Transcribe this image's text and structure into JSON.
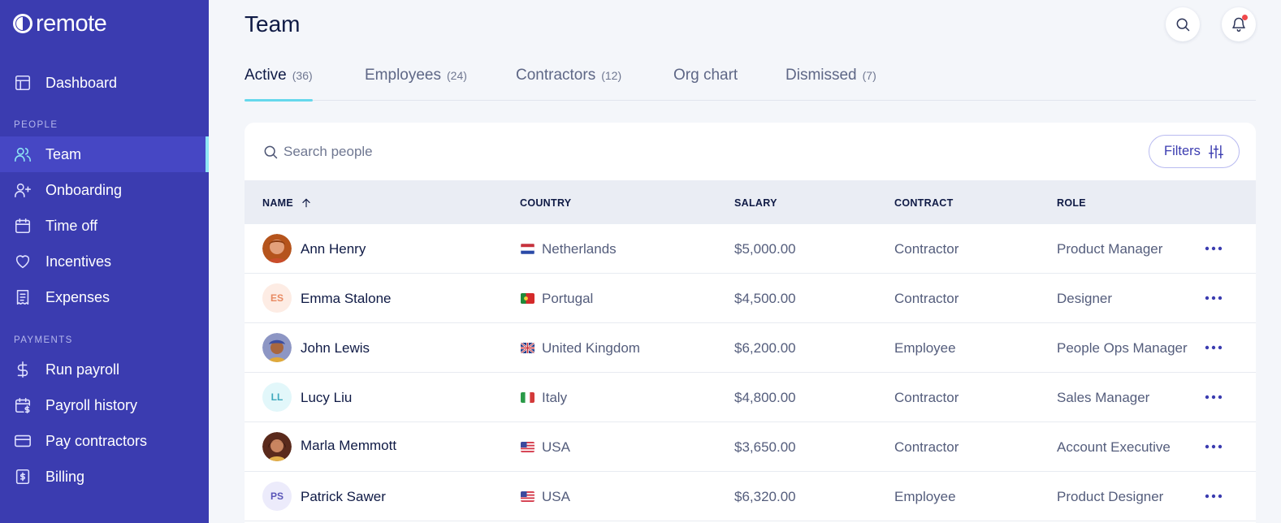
{
  "app": {
    "logo_text": "remote"
  },
  "sidebar": {
    "dashboard": "Dashboard",
    "people_label": "PEOPLE",
    "people_items": [
      {
        "label": "Team",
        "icon": "users-icon"
      },
      {
        "label": "Onboarding",
        "icon": "user-plus-icon"
      },
      {
        "label": "Time off",
        "icon": "calendar-icon"
      },
      {
        "label": "Incentives",
        "icon": "heart-icon"
      },
      {
        "label": "Expenses",
        "icon": "receipt-icon"
      }
    ],
    "payments_label": "PAYMENTS",
    "payment_items": [
      {
        "label": "Run payroll",
        "icon": "dollar-icon"
      },
      {
        "label": "Payroll history",
        "icon": "calendar-dollar-icon"
      },
      {
        "label": "Pay contractors",
        "icon": "credit-card-icon"
      },
      {
        "label": "Billing",
        "icon": "billing-icon"
      }
    ],
    "active_item": "Team"
  },
  "header": {
    "title": "Team"
  },
  "tabs": [
    {
      "label": "Active",
      "count": "(36)"
    },
    {
      "label": "Employees",
      "count": "(24)"
    },
    {
      "label": "Contractors",
      "count": "(12)"
    },
    {
      "label": "Org chart",
      "count": ""
    },
    {
      "label": "Dismissed",
      "count": "(7)"
    }
  ],
  "active_tab": "Active",
  "search": {
    "placeholder": "Search people",
    "value": ""
  },
  "filters_label": "Filters",
  "table": {
    "columns": [
      "NAME",
      "COUNTRY",
      "SALARY",
      "CONTRACT",
      "ROLE"
    ],
    "sort": {
      "column": "NAME",
      "direction": "ascending"
    },
    "rows": [
      {
        "name": "Ann Henry",
        "initials": "",
        "country": "Netherlands",
        "salary": "$5,000.00",
        "contract": "Contractor",
        "role": "Product Manager"
      },
      {
        "name": "Emma Stalone",
        "initials": "ES",
        "country": "Portugal",
        "salary": "$4,500.00",
        "contract": "Contractor",
        "role": "Designer"
      },
      {
        "name": "John Lewis",
        "initials": "",
        "country": "United Kingdom",
        "salary": "$6,200.00",
        "contract": "Employee",
        "role": "People Ops Manager"
      },
      {
        "name": "Lucy Liu",
        "initials": "LL",
        "country": "Italy",
        "salary": "$4,800.00",
        "contract": "Contractor",
        "role": "Sales Manager"
      },
      {
        "name": "Marla Memmott",
        "initials": "",
        "country": "USA",
        "salary": "$3,650.00",
        "contract": "Contractor",
        "role": "Account Executive"
      },
      {
        "name": "Patrick Sawer",
        "initials": "PS",
        "country": "USA",
        "salary": "$6,320.00",
        "contract": "Employee",
        "role": "Product Designer"
      }
    ]
  },
  "colors": {
    "sidebar_bg": "#3b3cb0",
    "sidebar_active_bg": "#4647c4",
    "accent_cyan": "#66d8ec",
    "notification_dot": "#f0484b",
    "link_purple": "#3b3cb0"
  }
}
